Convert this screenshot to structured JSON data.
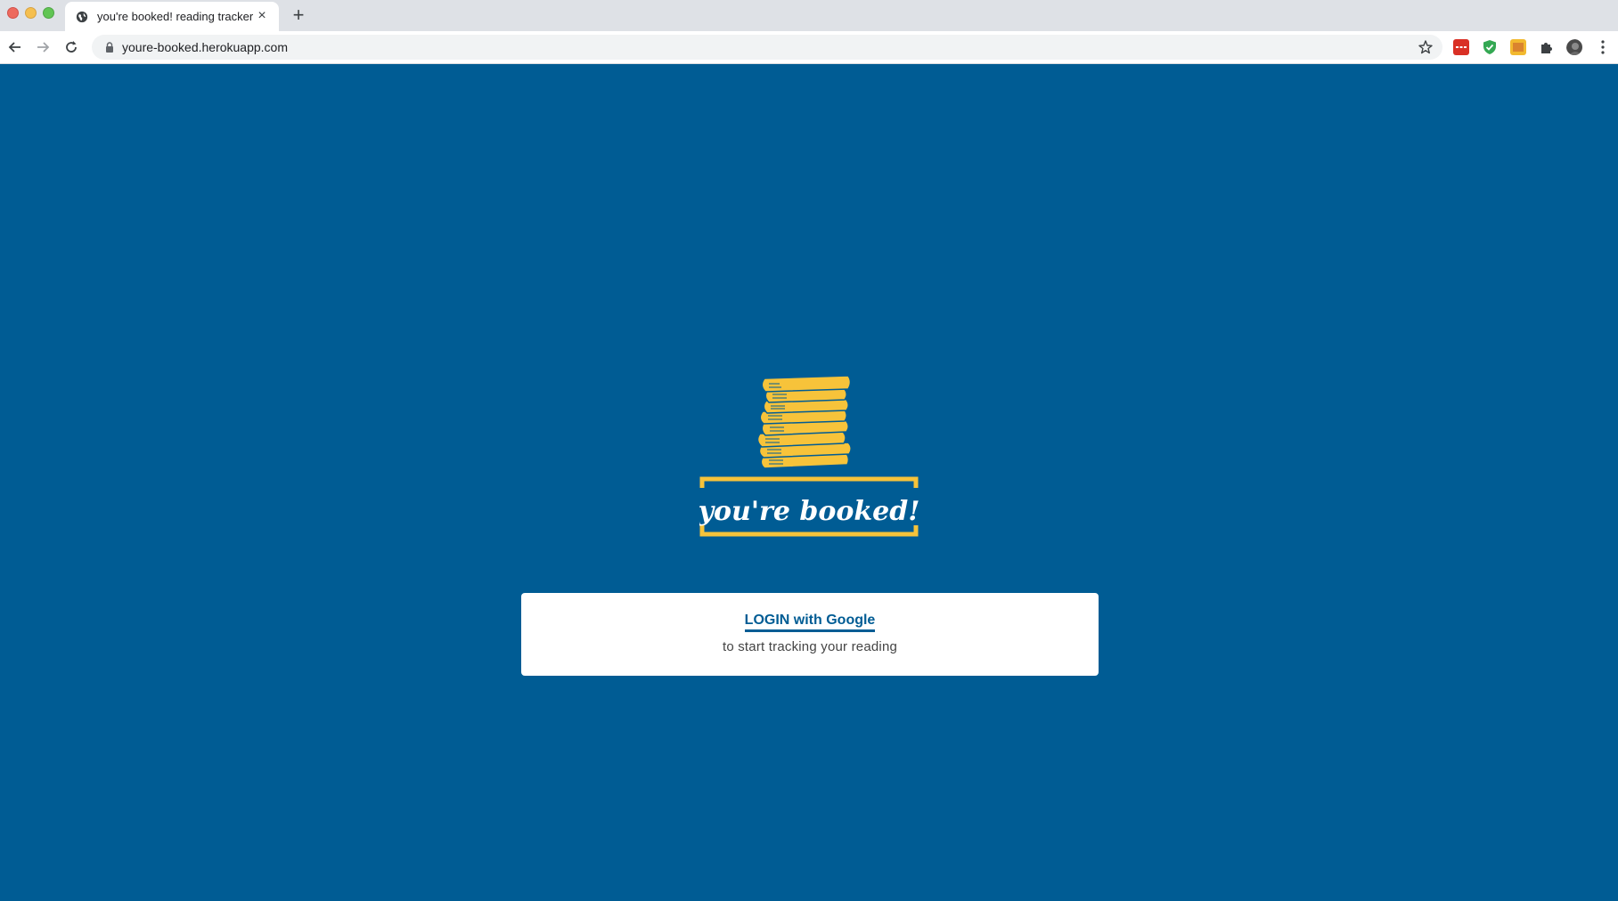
{
  "browser": {
    "tab_title": "you're booked! reading tracker",
    "tab_close": "×",
    "new_tab": "+",
    "url": "youre-booked.herokuapp.com"
  },
  "app": {
    "logo_text": "you're booked!",
    "login_label": "LOGIN with Google",
    "subtitle": "to start tracking your reading",
    "colors": {
      "background": "#005c94",
      "accent": "#f7c33a",
      "card": "#ffffff"
    }
  },
  "icons": {
    "favicon": "globe-icon",
    "back": "arrow-left-icon",
    "forward": "arrow-right-icon",
    "reload": "reload-icon",
    "lock": "lock-icon",
    "bookmark": "star-icon",
    "extensions": "puzzle-icon",
    "menu": "kebab-menu-icon"
  }
}
